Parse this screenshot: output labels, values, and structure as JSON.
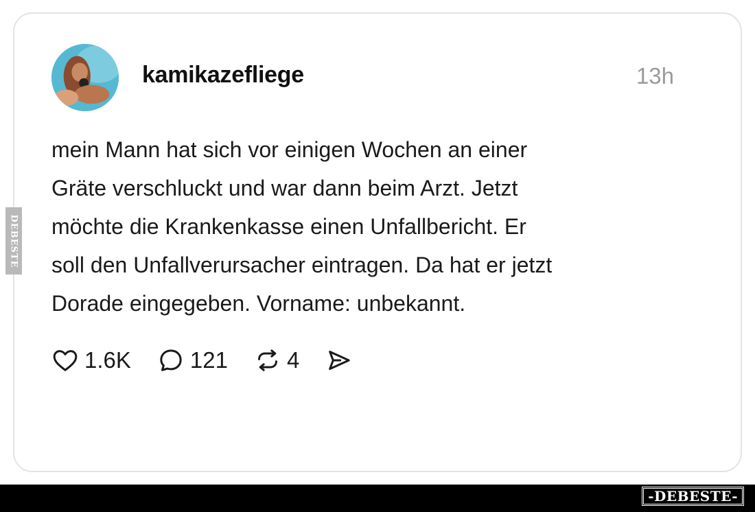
{
  "post": {
    "username": "kamikazefliege",
    "time": "13h",
    "lines": [
      "mein Mann hat sich vor einigen Wochen an einer",
      "Gräte verschluckt und war dann beim Arzt. Jetzt",
      "möchte die Krankenkasse einen Unfallbericht. Er",
      "soll den Unfallverursacher eintragen. Da hat er jetzt",
      "Dorade eingegeben. Vorname: unbekannt."
    ]
  },
  "actions": {
    "likes": "1.6K",
    "comments": "121",
    "reposts": "4",
    "icons": [
      "heart-icon",
      "comment-icon",
      "repost-icon",
      "share-icon"
    ]
  },
  "watermark": {
    "bottom": "-DEBESTE-",
    "side": "DEBESTE"
  },
  "colors": {
    "card_border": "#e3e3e3",
    "time_gray": "#9a9a9a",
    "text": "#1a1a1a",
    "footer_bar": "#000000"
  }
}
